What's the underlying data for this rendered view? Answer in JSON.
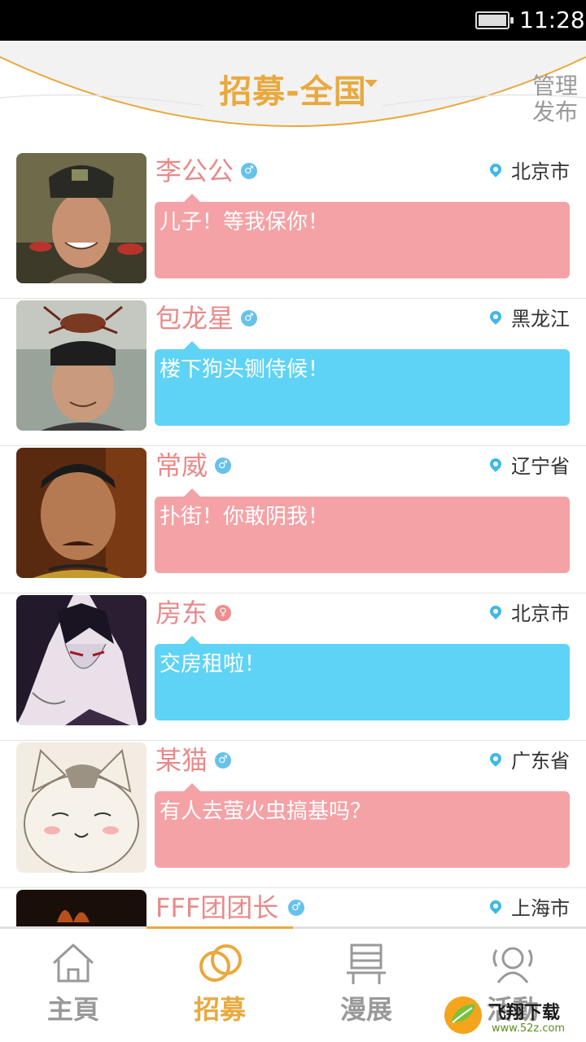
{
  "status_bar": {
    "time": "11:28"
  },
  "header": {
    "title": "招募-全国",
    "manage_line1": "管理",
    "manage_line2": "发布"
  },
  "posts": [
    {
      "name": "李公公",
      "gender": "male",
      "gender_symbol": "♂",
      "location": "北京市",
      "message": "儿子！等我保你！",
      "bubble_color": "pink"
    },
    {
      "name": "包龙星",
      "gender": "male",
      "gender_symbol": "♂",
      "location": "黑龙江",
      "message": "楼下狗头铡侍候！",
      "bubble_color": "blue"
    },
    {
      "name": "常威",
      "gender": "male",
      "gender_symbol": "♂",
      "location": "辽宁省",
      "message": "扑街！你敢阴我！",
      "bubble_color": "pink"
    },
    {
      "name": "房东",
      "gender": "female",
      "gender_symbol": "♀",
      "location": "北京市",
      "message": "交房租啦！",
      "bubble_color": "blue"
    },
    {
      "name": "某猫",
      "gender": "male",
      "gender_symbol": "♂",
      "location": "广东省",
      "message": "有人去萤火虫搞基吗？",
      "bubble_color": "pink"
    },
    {
      "name": "FFF团团长",
      "gender": "male",
      "gender_symbol": "♂",
      "location": "上海市",
      "message": "",
      "bubble_color": "blue"
    }
  ],
  "nav": {
    "items": [
      {
        "label": "主頁",
        "icon": "home-icon"
      },
      {
        "label": "招募",
        "icon": "rings-icon",
        "active": true
      },
      {
        "label": "漫展",
        "icon": "exhibition-icon"
      },
      {
        "label": "活動",
        "icon": "activity-icon"
      }
    ]
  },
  "watermark": {
    "text": "飞翔下载",
    "url": "www.52z.com"
  },
  "colors": {
    "accent": "#e8a93e",
    "pink": "#f4a2a6",
    "blue": "#5ed3f5",
    "name": "#e88a8a"
  }
}
